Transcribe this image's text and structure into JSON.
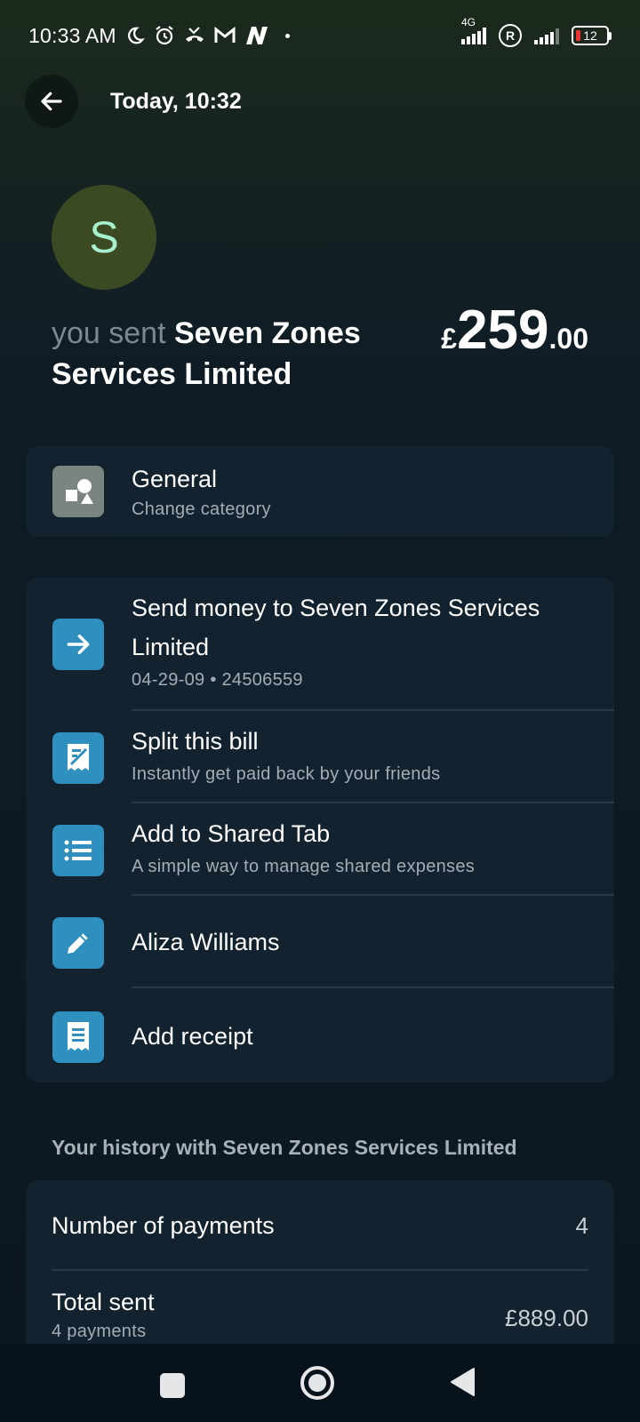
{
  "status_bar": {
    "time": "10:33 AM",
    "network_label": "4G",
    "roaming_label": "R",
    "battery_level": "12"
  },
  "header": {
    "title": "Today, 10:32"
  },
  "transaction": {
    "avatar_initial": "S",
    "prefix": "you sent",
    "recipient": "Seven Zones Services Limited",
    "amount_currency": "£",
    "amount_whole": "259",
    "amount_decimal": ".00"
  },
  "category": {
    "title": "General",
    "subtitle": "Change category"
  },
  "actions": [
    {
      "title": "Send money to Seven Zones Services Limited",
      "subtitle": "04-29-09 • 24506559",
      "icon": "arrow-right-icon"
    },
    {
      "title": "Split this bill",
      "subtitle": "Instantly get paid back by your friends",
      "icon": "split-bill-icon"
    },
    {
      "title": "Add to Shared Tab",
      "subtitle": "A simple way to manage shared expenses",
      "icon": "list-icon"
    },
    {
      "title": "Aliza Williams",
      "subtitle": "",
      "icon": "pencil-icon"
    },
    {
      "title": "Add receipt",
      "subtitle": "",
      "icon": "receipt-icon"
    }
  ],
  "history": {
    "heading": "Your history with Seven Zones Services Limited",
    "payments_label": "Number of payments",
    "payments_value": "4",
    "total_label": "Total sent",
    "total_sub": "4 payments",
    "total_value": "£889.00"
  },
  "colors": {
    "accent": "#2f8fbf",
    "category_icon_bg": "#7b8580",
    "card_bg": "#13222f"
  }
}
